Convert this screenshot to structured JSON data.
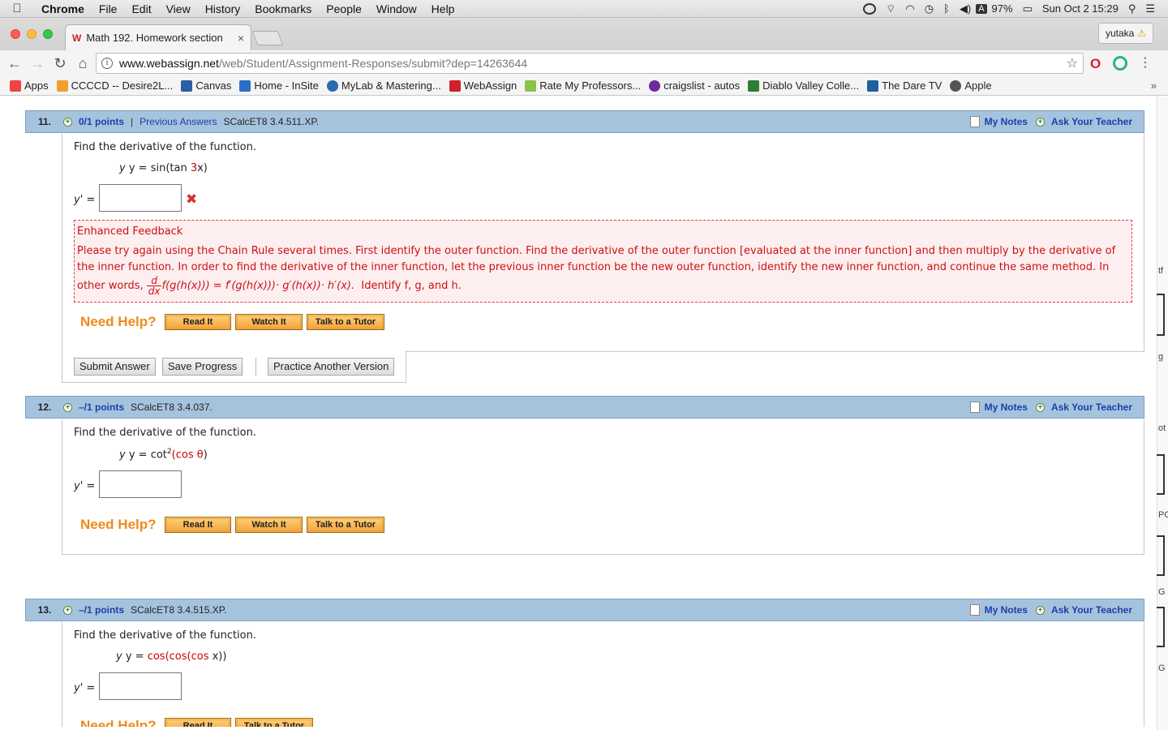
{
  "menubar": {
    "app_name": "Chrome",
    "items": [
      "File",
      "Edit",
      "View",
      "History",
      "Bookmarks",
      "People",
      "Window",
      "Help"
    ],
    "battery": "97%",
    "datetime": "Sun Oct 2  15:29",
    "input_source": "A"
  },
  "tab": {
    "title": "Math 192. Homework section",
    "favicon_text": "W",
    "close": "×"
  },
  "profile": {
    "name": "yutaka"
  },
  "address": {
    "host": "www.webassign.net",
    "path": "/web/Student/Assignment-Responses/submit?dep=14263644"
  },
  "bookmarks": [
    {
      "label": "Apps",
      "icon_color": "#4285f4",
      "icon_text": "⋮⋮"
    },
    {
      "label": "CCCCD -- Desire2L...",
      "icon_color": "#f0a030",
      "icon_text": "✻"
    },
    {
      "label": "Canvas",
      "icon_color": "#2a5fa8",
      "icon_text": "C"
    },
    {
      "label": "Home - InSite",
      "icon_color": "#2d6fc4",
      "icon_text": "S"
    },
    {
      "label": "MyLab & Mastering...",
      "icon_color": "#2a6cb0",
      "icon_text": "P"
    },
    {
      "label": "WebAssign",
      "icon_color": "#d0202a",
      "icon_text": "WA"
    },
    {
      "label": "Rate My Professors...",
      "icon_color": "#8bc34a",
      "icon_text": "R"
    },
    {
      "label": "craigslist - autos",
      "icon_color": "#6a2b9a",
      "icon_text": "☮"
    },
    {
      "label": "Diablo Valley Colle...",
      "icon_color": "#2e7d32",
      "icon_text": "D"
    },
    {
      "label": "The Dare TV",
      "icon_color": "#1e5fa0",
      "icon_text": "▭"
    },
    {
      "label": "Apple",
      "icon_color": "#555555",
      "icon_text": ""
    }
  ],
  "bookmarks_more": "»",
  "questions": [
    {
      "num": "11.",
      "points": "0/1 points",
      "separator": "|",
      "previous_answers": "Previous Answers",
      "source": "SCalcET8 3.4.511.XP.",
      "prompt": "Find the derivative of the function.",
      "expr_prefix": "y = sin(tan ",
      "expr_red": "3",
      "expr_suffix": "x)",
      "answer_label": "y' ="
    },
    {
      "num": "12.",
      "points": "–/1 points",
      "source": "SCalcET8 3.4.037.",
      "prompt": "Find the derivative of the function.",
      "expr_prefix": "y = cot",
      "expr_sup": "2",
      "expr_red": "(cos θ",
      "expr_suffix": ")",
      "answer_label": "y' ="
    },
    {
      "num": "13.",
      "points": "–/1 points",
      "source": "SCalcET8 3.4.515.XP.",
      "prompt": "Find the derivative of the function.",
      "expr_prefix": "y = ",
      "expr_red": "cos(cos(cos ",
      "expr_suffix": "x))",
      "answer_label": "y' ="
    }
  ],
  "header_links": {
    "notes": "My Notes",
    "ask": "Ask Your Teacher"
  },
  "feedback": {
    "title": "Enhanced Feedback",
    "line1": "Please try again using the Chain Rule several times. First identify the outer function. Find the derivative of the outer function [evaluated at the inner function] and then multiply by the derivative of",
    "line2": "the inner function. In order to find the derivative of the inner function, let the previous inner function be the new outer function, identify the new inner function, and continue the same method. In",
    "line3_pre": "other words,",
    "frac_num": "d",
    "frac_den": "dx",
    "formula": "f(g(h(x))) = f′(g(h(x)))· g′(h(x))· h′(x).",
    "identify": "Identify f, g, and h."
  },
  "help": {
    "label": "Need Help?",
    "read": "Read It",
    "watch": "Watch It",
    "tutor": "Talk to a Tutor"
  },
  "actions": {
    "submit": "Submit Answer",
    "save": "Save Progress",
    "practice": "Practice Another Version"
  },
  "side_fragments": [
    "tf",
    "g",
    "ot",
    "PG",
    "G",
    "G"
  ]
}
